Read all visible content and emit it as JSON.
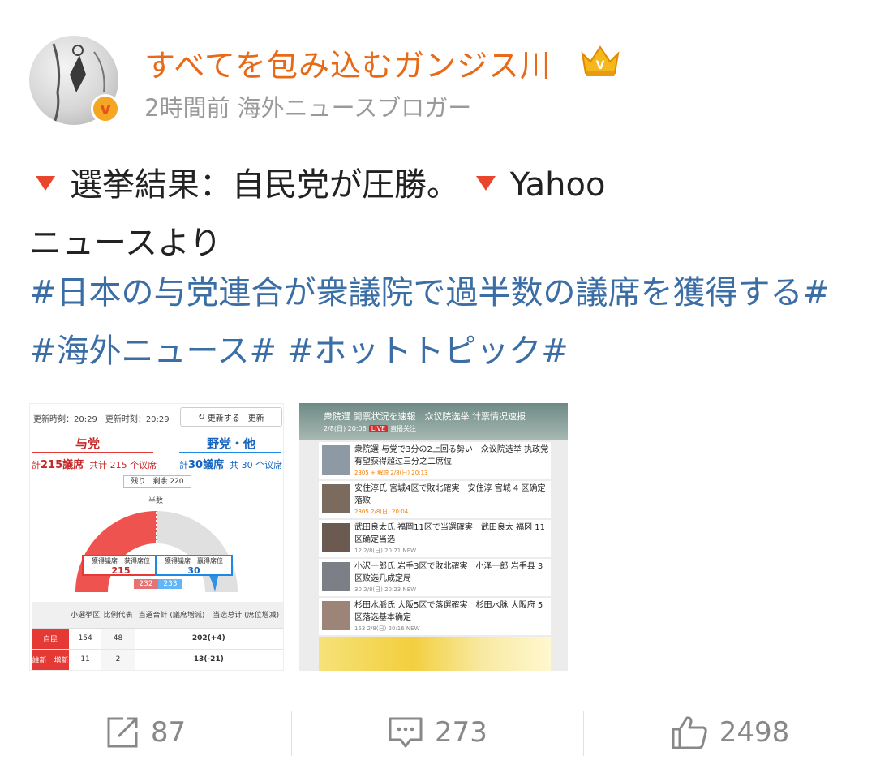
{
  "user": {
    "name": "すべてを包み込むガンジス川",
    "time": "2時間前",
    "role": "海外ニュースブロガー",
    "verified_mark": "v"
  },
  "post": {
    "line1": "選挙結果：自民党が圧勝。",
    "line1b": "Yahoo",
    "line2": "ニュースより",
    "tag1": "#日本の与党連合が衆議院で過半数の議席を獲得する#",
    "tag2": "#海外ニュース#",
    "tag3": "#ホットトピック#"
  },
  "image1": {
    "updated": "更新時刻：20:29　更新时刻：20:29",
    "refresh": "更新する　更新",
    "ruling": "与党",
    "opposition": "野党・他",
    "ruling_count_label": "計",
    "ruling_count": "215議席",
    "ruling_count_cn": "共计 215 个议席",
    "opp_count_label": "計",
    "opp_count": "30議席",
    "opp_count_cn": "共 30 个议席",
    "remaining": "残り　剩余 220",
    "half": "半数",
    "won_label": "獲得議席　获得席位",
    "won_value": "215",
    "won_label_b": "獲得議席　赢得席位",
    "won_value_b": "30",
    "majority_r": "232",
    "majority_b": "233",
    "table_headers": [
      "",
      "小選挙区",
      "比例代表",
      "当選合計\n(議席増減)",
      "当选总计\n(席位增减)"
    ],
    "rows": [
      {
        "party": "自民",
        "district": "154",
        "pr": "48",
        "total": "202",
        "change": "(+4)"
      },
      {
        "party": "維新　増新",
        "district": "11",
        "pr": "2",
        "total": "13",
        "change": "(-21)"
      }
    ]
  },
  "image2": {
    "header": "衆院選 開票状況を速報　众议院选举 计票情况速报",
    "header_sub_date": "2/8(日) 20:06",
    "header_live": "LIVE",
    "header_follow": "直播关注",
    "items": [
      {
        "title": "衆院選 与党で3分の2上回る勢い　众议院选举 执政党有望获得超过三分之二席位",
        "meta": "2305 + 解説  2/8(日) 20:13"
      },
      {
        "title": "安住淳氏 宮城4区で敗北確実　安住淳 宫城 4 区确定落败",
        "meta": "2305  2/8(日) 20:04"
      },
      {
        "title": "武田良太氏 福岡11区で当選確実　武田良太 福冈 11 区确定当选",
        "meta": "12  2/8(日) 20:21  NEW"
      },
      {
        "title": "小沢一郎氏 岩手3区で敗北確実　小泽一郎 岩手县 3 区败选几成定局",
        "meta": "30  2/8(日) 20:23  NEW"
      },
      {
        "title": "杉田水脈氏 大阪5区で落選確実　杉田水脉 大阪府 5 区落选基本确定",
        "meta": "153  2/8(日) 20:16  NEW"
      }
    ]
  },
  "actions": {
    "repost_count": "87",
    "comment_count": "273",
    "like_count": "2498"
  },
  "colors": {
    "username": "#e86a17",
    "hashtag": "#3b6ea5",
    "accent_triangle": "#e8452c"
  }
}
